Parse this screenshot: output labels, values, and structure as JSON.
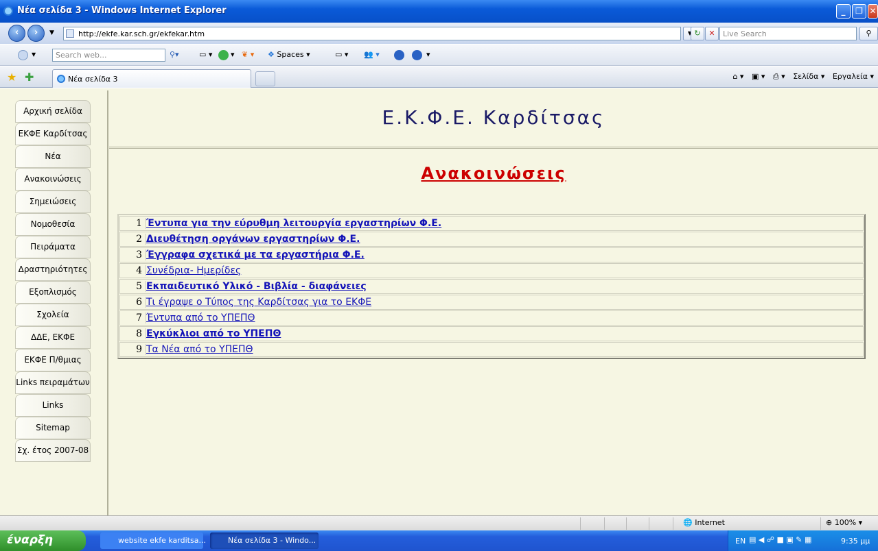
{
  "window": {
    "title": "Νέα σελίδα 3 - Windows Internet Explorer"
  },
  "address": {
    "url": "http://ekfe.kar.sch.gr/ekfekar.htm",
    "live_search_placeholder": "Live Search"
  },
  "toolbar": {
    "search_placeholder": "Search web...",
    "spaces_label": "Spaces"
  },
  "tabs": {
    "active_label": "Νέα σελίδα 3"
  },
  "commandbar": {
    "page_label": "Σελίδα ▾",
    "tools_label": "Εργαλεία ▾"
  },
  "nav": [
    "Αρχική σελίδα",
    "ΕΚΦΕ Καρδίτσας",
    "Νέα",
    "Ανακοινώσεις",
    "Σημειώσεις",
    "Νομοθεσία",
    "Πειράματα",
    "Δραστηριότητες",
    "Εξοπλισμός",
    "Σχολεία",
    "ΔΔΕ, ΕΚΦΕ",
    "ΕΚΦΕ Π/θμιας",
    "Links πειραμάτων",
    "Links",
    "Sitemap",
    "Σχ. έτος 2007-08"
  ],
  "page": {
    "site_title": "Ε.Κ.Φ.Ε. Καρδίτσας",
    "section_title": "Ανακοινώσεις"
  },
  "announcements": [
    {
      "num": "1",
      "text": "Έντυπα για την εύρυθμη λειτουργία εργαστηρίων Φ.Ε.",
      "bold": true
    },
    {
      "num": "2",
      "text": "Διευθέτηση οργάνων εργαστηρίων Φ.Ε.",
      "bold": true
    },
    {
      "num": "3",
      "text": "Έγγραφα σχετικά με τα εργαστήρια Φ.Ε.",
      "bold": true
    },
    {
      "num": "4",
      "text": "Συνέδρια- Ημερίδες",
      "bold": false
    },
    {
      "num": "5",
      "text": "Εκπαιδευτικό Υλικό - Βιβλία - διαφάνειες",
      "bold": true
    },
    {
      "num": "6",
      "text": "Τι έγραψε ο Τύπος της Καρδίτσας για το ΕΚΦΕ",
      "bold": false
    },
    {
      "num": "7",
      "text": "Έντυπα από το ΥΠΕΠΘ",
      "bold": false
    },
    {
      "num": "8",
      "text": "Εγκύκλιοι από το ΥΠΕΠΘ",
      "bold": true
    },
    {
      "num": "9",
      "text": "Τα Νέα από το ΥΠΕΠΘ",
      "bold": false
    }
  ],
  "statusbar": {
    "zone": "Internet",
    "zoom": "100%"
  },
  "taskbar": {
    "start": "έναρξη",
    "task1": "website ekfe karditsa...",
    "task2": "Νέα σελίδα 3 - Windo...",
    "lang": "EN",
    "clock": "9:35 μμ"
  }
}
